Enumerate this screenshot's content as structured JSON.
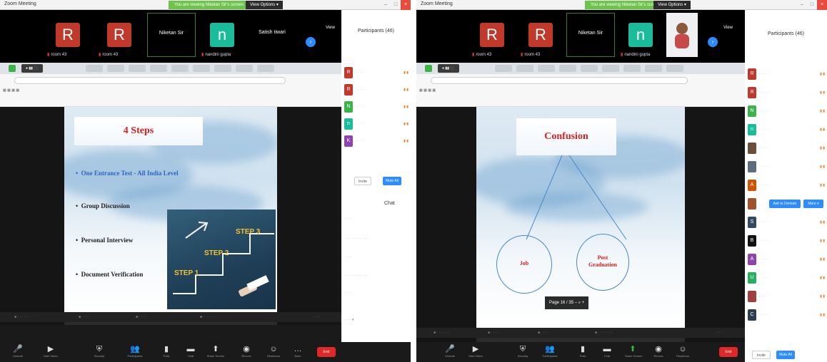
{
  "left": {
    "window_title": "Zoom Meeting",
    "talking_banner": "You are viewing Niketan Sir's screen",
    "view_options": "View Options ▾",
    "gallery_tiles": [
      {
        "letter": "R",
        "name": "room 43",
        "color": "#c0392b"
      },
      {
        "letter": "R",
        "name": "room 43",
        "color": "#c0392b"
      },
      {
        "letter": "",
        "name": "Niketan Sir",
        "color": ""
      },
      {
        "letter": "n",
        "name": "nandini gupta",
        "color": "#1abc9c"
      },
      {
        "letter": "",
        "name": "Satish tiwari",
        "color": ""
      }
    ],
    "view_label": "View",
    "participants_title": "Participants (46)",
    "slide": {
      "title": "4 Steps",
      "bullets": [
        "One Entrance Test - All India Level",
        "Group Discussion",
        "Personal Interview",
        "Document Verification"
      ],
      "steps": [
        "STEP 1",
        "STEP 2",
        "STEP 3"
      ]
    },
    "chat_title": "Chat",
    "sidebar_buttons": [
      "Invite",
      "Mute All"
    ],
    "toolbar": [
      "Unmute",
      "Start Video",
      "Security",
      "Participants",
      "Polls",
      "Chat",
      "Share Screen",
      "Record",
      "Reactions",
      "More"
    ],
    "end_label": "End"
  },
  "right": {
    "window_title": "Zoom Meeting",
    "talking_banner": "You are viewing Niketan Sir's screen",
    "view_options": "View Options ▾",
    "gallery_tiles": [
      {
        "letter": "R",
        "name": "room 43",
        "color": "#c0392b"
      },
      {
        "letter": "R",
        "name": "room 43",
        "color": "#c0392b"
      },
      {
        "letter": "",
        "name": "Niketan Sir",
        "color": ""
      },
      {
        "letter": "n",
        "name": "nandini gupta",
        "color": "#1abc9c"
      },
      {
        "letter": "",
        "name": "",
        "color": ""
      }
    ],
    "view_label": "View",
    "participants_title": "Participants (46)",
    "slide": {
      "title": "Confusion",
      "left_circle": "Job",
      "right_circle": "Post Graduation"
    },
    "zoom_control": "Page 16 / 35  –  ⌕  +",
    "participant_buttons": [
      "Ask to Unmute",
      "More ▾"
    ],
    "sidebar_buttons": [
      "Invite",
      "Mute All"
    ],
    "toolbar": [
      "Unmute",
      "Start Video",
      "Security",
      "Participants",
      "Polls",
      "Chat",
      "Share Screen",
      "Record",
      "Reactions",
      "More"
    ],
    "end_label": "End"
  }
}
